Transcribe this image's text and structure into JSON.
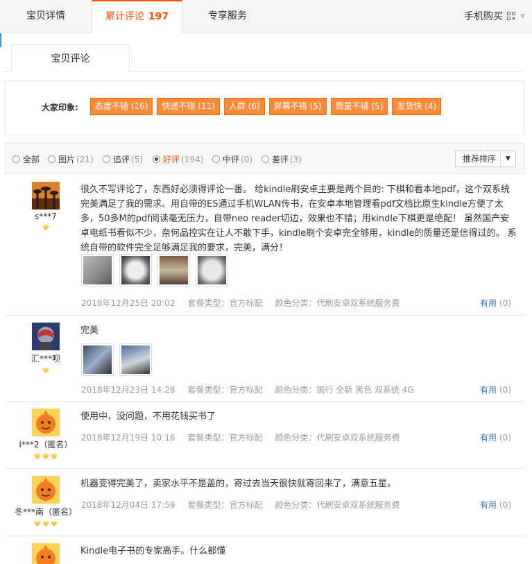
{
  "tabs": {
    "detail": "宝贝详情",
    "reviews": "累计评论",
    "reviews_count": "197",
    "service": "专享服务",
    "mobile_buy": "手机购买"
  },
  "subtab": "宝贝评论",
  "impressions": {
    "label": "大家印象:",
    "tags": [
      "态度不错 (16)",
      "快递不错 (11)",
      "人群 (6)",
      "屏幕不错 (5)",
      "质量不错 (5)",
      "发货快 (4)"
    ]
  },
  "filters": [
    {
      "label": "全部",
      "num": ""
    },
    {
      "label": "图片",
      "num": "(21)"
    },
    {
      "label": "追评",
      "num": "(5)"
    },
    {
      "label": "好评",
      "num": "(194)"
    },
    {
      "label": "中评",
      "num": "(0)"
    },
    {
      "label": "差评",
      "num": "(3)"
    }
  ],
  "sort_label": "推荐排序",
  "accent_color": "#ff5000",
  "reviews": [
    {
      "user": "s***7",
      "rank_level": 1,
      "text": "很久不写评论了，东西好必须得评论一番。 给kindle刷安卓主要是两个目的: 下棋和看本地pdf，这个双系统完美满足了我的需求。用自带的ES通过手机WLAN传书，在安卓本地管理看pdf文档比原生kindle方便了太多，50多M的pdf阅读毫无压力，自带neo reader切边，效果也不错；用kindle下棋更是绝配！ 虽然国产安卓电纸书看似不少，奈何品控实在让人不敢下手，kindle刷个安卓完全够用，kindle的质量还是信得过的。 系统自带的软件完全足够满足我的要求，完美，满分！",
      "date": "2018年12月25日 20:02",
      "package": "套餐类型：官方标配",
      "color": "颜色分类：代刷安卓双系统服务费",
      "useful": "有用",
      "useful_count": "(0)"
    },
    {
      "user": "汇***呗",
      "rank_level": 1,
      "text": "完美",
      "date": "2018年12月23日 14:28",
      "package": "套餐类型：官方标配",
      "color": "颜色分类：国行 全新 黑色 双系统 4G",
      "useful": "有用",
      "useful_count": "(0)"
    },
    {
      "user": "l***2（匿名）",
      "rank_level": 3,
      "text": "使用中，没问题，不用花钱买书了",
      "date": "2018年12月19日 10:16",
      "package": "套餐类型：官方标配",
      "color": "颜色分类：代刷安卓双系统服务费",
      "useful": "有用",
      "useful_count": "(0)"
    },
    {
      "user": "冬***南（匿名）",
      "rank_level": 3,
      "text": "机器变得完美了，卖家水平不是盖的，寄过去当天很快就寄回来了，满意五星。",
      "date": "2018年12月04日 17:59",
      "package": "套餐类型：官方标配",
      "color": "颜色分类：代刷安卓双系统服务费",
      "useful": "有用",
      "useful_count": "(0)"
    },
    {
      "text": "Kindle电子书的专家高手。什么都懂"
    }
  ]
}
